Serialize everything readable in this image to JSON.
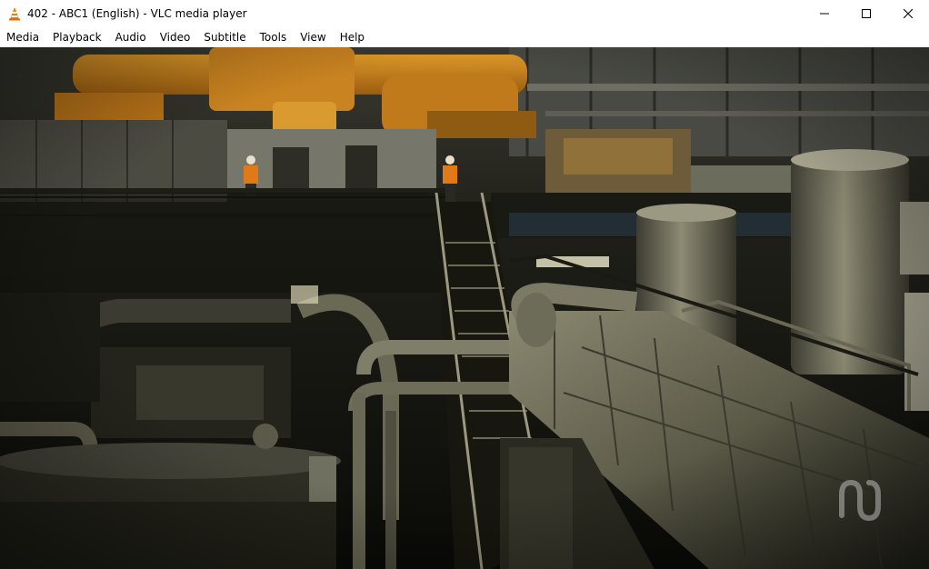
{
  "window": {
    "title": "402 - ABC1 (English) - VLC media player",
    "app_icon": "vlc-cone-icon",
    "caption_buttons": [
      "minimize-icon",
      "maximize-icon",
      "close-icon"
    ]
  },
  "menubar": {
    "items": [
      {
        "label": "Media"
      },
      {
        "label": "Playback"
      },
      {
        "label": "Audio"
      },
      {
        "label": "Video"
      },
      {
        "label": "Subtitle"
      },
      {
        "label": "Tools"
      },
      {
        "label": "View"
      },
      {
        "label": "Help"
      }
    ]
  },
  "video": {
    "scene": "industrial-plant-interior",
    "watermark": "ABC",
    "colors": {
      "pipes_orange": "#d08a1c",
      "steel_dark": "#2a2a22",
      "highlight": "#b8b79a"
    }
  }
}
